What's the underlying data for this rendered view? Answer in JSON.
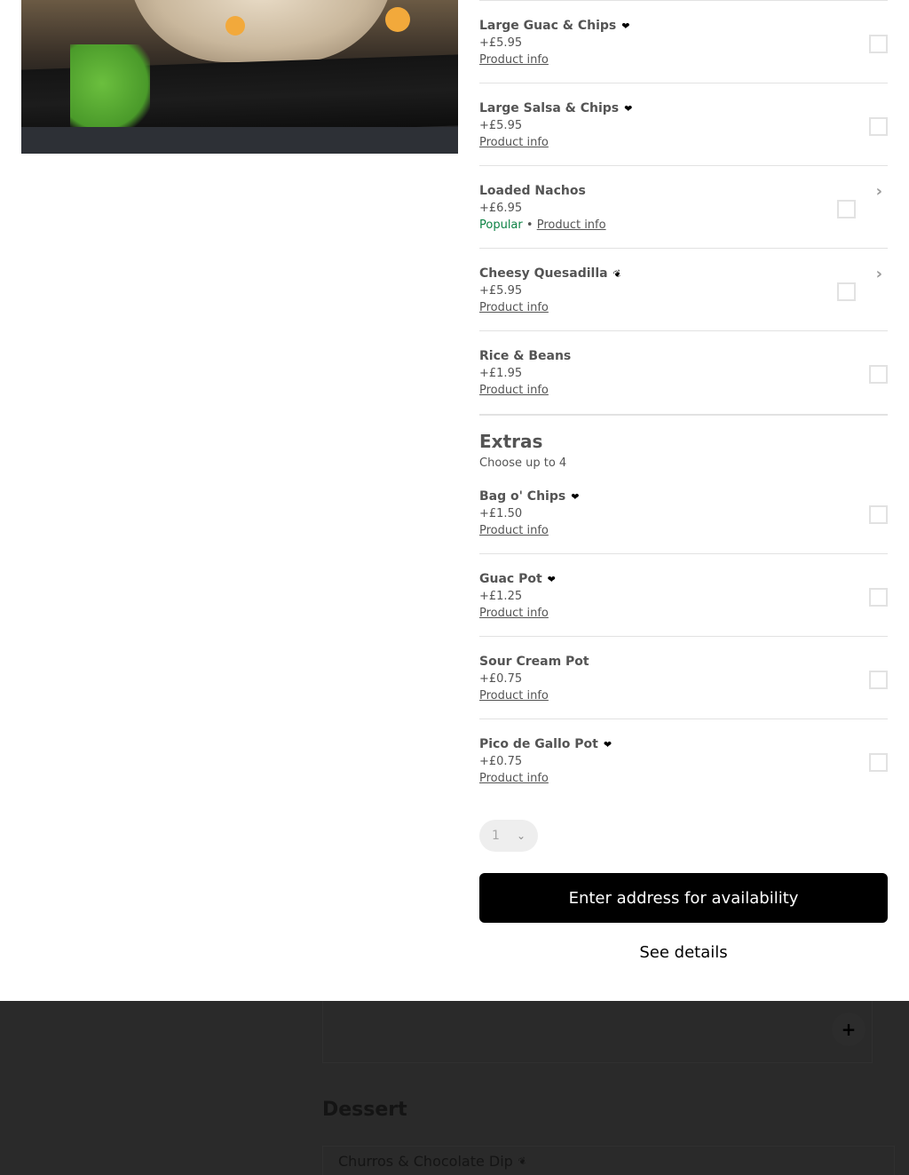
{
  "options": [
    {
      "name": "Large Guac & Chips",
      "icon": "heart-icon",
      "price": "+£5.95",
      "popular": "",
      "info": "Product info",
      "chevron": false
    },
    {
      "name": "Large Salsa & Chips",
      "icon": "heart-icon",
      "price": "+£5.95",
      "popular": "",
      "info": "Product info",
      "chevron": false
    },
    {
      "name": "Loaded Nachos",
      "icon": "",
      "price": "+£6.95",
      "popular": "Popular",
      "info": "Product info",
      "chevron": true
    },
    {
      "name": "Cheesy Quesadilla",
      "icon": "leaf-icon",
      "price": "+£5.95",
      "popular": "",
      "info": "Product info",
      "chevron": true
    },
    {
      "name": "Rice & Beans",
      "icon": "",
      "price": "+£1.95",
      "popular": "",
      "info": "Product info",
      "chevron": false
    }
  ],
  "extras": {
    "title": "Extras",
    "subtitle": "Choose up to 4",
    "items": [
      {
        "name": "Bag o' Chips",
        "icon": "heart-icon",
        "price": "+£1.50",
        "info": "Product info"
      },
      {
        "name": "Guac Pot",
        "icon": "heart-icon",
        "price": "+£1.25",
        "info": "Product info"
      },
      {
        "name": "Sour Cream Pot",
        "icon": "",
        "price": "+£0.75",
        "info": "Product info"
      },
      {
        "name": "Pico de Gallo Pot",
        "icon": "heart-icon",
        "price": "+£0.75",
        "info": "Product info"
      }
    ]
  },
  "quantity": {
    "value": "1"
  },
  "cta": {
    "label": "Enter address for availability"
  },
  "details": {
    "label": "See details"
  },
  "background": {
    "section_title": "Dessert",
    "item": "Churros & Chocolate Dip",
    "plus": "+"
  }
}
